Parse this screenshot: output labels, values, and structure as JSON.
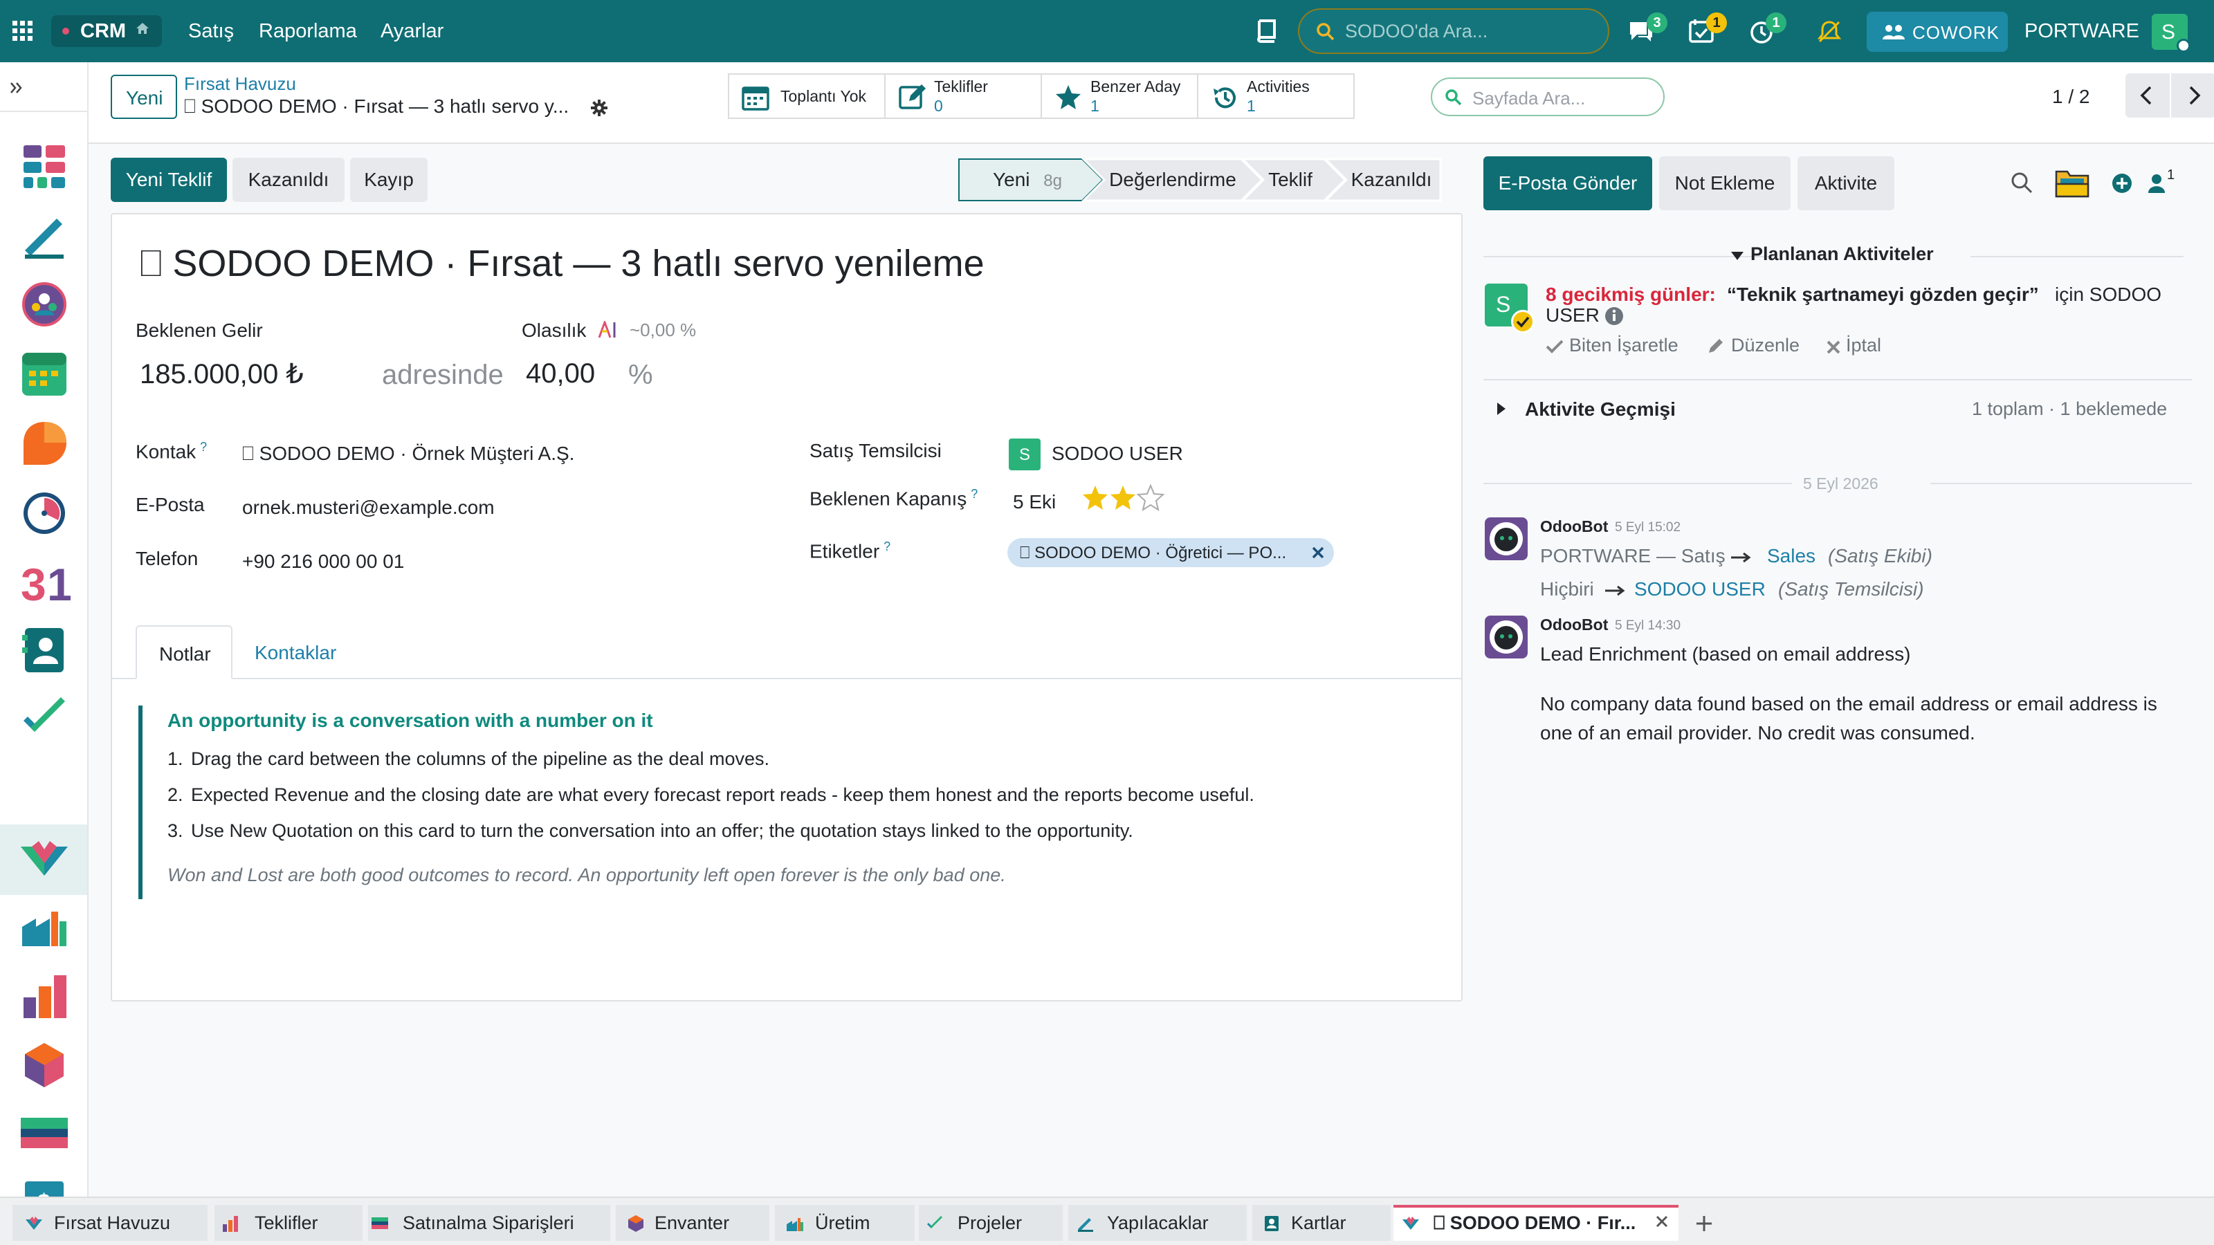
{
  "topbar": {
    "app_name": "CRM",
    "menus": [
      "Satış",
      "Raporlama",
      "Ayarlar"
    ],
    "search_placeholder": "SODOO'da Ara...",
    "badge_messages": "3",
    "badge_activities": "1",
    "badge_timer": "1",
    "cowork_label": "COWORK",
    "company": "PORTWARE",
    "avatar_letter": "S"
  },
  "control": {
    "new_label": "Yeni",
    "breadcrumb_parent": "Fırsat Havuzu",
    "breadcrumb_current": "⎕ SODOO DEMO · Fırsat — 3 hatlı servo y...",
    "smart_buttons": [
      {
        "label": "Toplantı Yok",
        "count": ""
      },
      {
        "label": "Teklifler",
        "count": "0"
      },
      {
        "label": "Benzer Aday",
        "count": "1"
      },
      {
        "label": "Activities",
        "count": "1"
      }
    ],
    "page_search_placeholder": "Sayfada Ara...",
    "pager": "1 / 2"
  },
  "actions": {
    "new_quotation": "Yeni Teklif",
    "won": "Kazanıldı",
    "lost": "Kayıp"
  },
  "stages": [
    {
      "label": "Yeni",
      "days": "8g",
      "active": true
    },
    {
      "label": "Değerlendirme"
    },
    {
      "label": "Teklif"
    },
    {
      "label": "Kazanıldı"
    }
  ],
  "form": {
    "title": "⎕ SODOO DEMO · Fırsat — 3 hatlı servo yenileme",
    "expected_revenue_label": "Beklenen Gelir",
    "expected_revenue": "185.000,00 ₺",
    "at_label": "adresinde",
    "probability_label": "Olasılık",
    "probability_ai": "~0,00 %",
    "probability": "40,00",
    "percent": "%",
    "contact_label": "Kontak",
    "contact": "⎕ SODOO DEMO · Örnek Müşteri A.Ş.",
    "email_label": "E-Posta",
    "email": "ornek.musteri@example.com",
    "phone_label": "Telefon",
    "phone": "+90 216 000 00 01",
    "salesperson_label": "Satış Temsilcisi",
    "salesperson": "SODOO USER",
    "salesperson_avatar": "S",
    "expected_closing_label": "Beklenen Kapanış",
    "expected_closing": "5 Eki",
    "priority_stars": 2,
    "tags_label": "Etiketler",
    "tag": "⎕ SODOO DEMO · Öğretici — PO...",
    "help_mark": "?"
  },
  "tabs": [
    "Notlar",
    "Kontaklar"
  ],
  "notes": {
    "heading": "An opportunity is a conversation with a number on it",
    "items": [
      "Drag the card between the columns of the pipeline as the deal moves.",
      "Expected Revenue and the closing date are what every forecast report reads - keep them honest and the reports become useful.",
      "Use New Quotation on this card to turn the conversation into an offer; the quotation stays linked to the opportunity."
    ],
    "footer": "Won and Lost are both good outcomes to record. An opportunity left open forever is the only bad one."
  },
  "chatter": {
    "send_email": "E-Posta Gönder",
    "log_note": "Not Ekleme",
    "activity": "Aktivite",
    "followers_count": "1",
    "planned_title": "Planlanan Aktiviteler",
    "overdue": "8 gecikmiş günler:",
    "activity_title": "“Teknik şartnameyi gözden geçir”",
    "for_user": "için SODOO",
    "for_user2": "USER",
    "mark_done": "Biten İşaretle",
    "edit": "Düzenle",
    "cancel": "İptal",
    "history_title": "Aktivite Geçmişi",
    "history_summary": "1 toplam · 1 beklemede",
    "date_separator": "5 Eyl 2026",
    "messages": [
      {
        "author": "OdooBot",
        "time": "5 Eyl 15:02",
        "changes": [
          {
            "old": "PORTWARE — Satış",
            "new": "Sales",
            "field": "(Satış Ekibi)"
          },
          {
            "old": "Hiçbiri",
            "new": "SODOO USER",
            "field": "(Satış Temsilcisi)"
          }
        ]
      },
      {
        "author": "OdooBot",
        "time": "5 Eyl 14:30",
        "body1": "Lead Enrichment (based on email address)",
        "body2": "No company data found based on the email address or email address is",
        "body3": "one of an email provider. No credit was consumed."
      }
    ]
  },
  "bottom_tabs": [
    {
      "label": "Fırsat Havuzu"
    },
    {
      "label": "Teklifler"
    },
    {
      "label": "Satınalma Siparişleri"
    },
    {
      "label": "Envanter"
    },
    {
      "label": "Üretim"
    },
    {
      "label": "Projeler"
    },
    {
      "label": "Yapılacaklar"
    },
    {
      "label": "Kartlar"
    },
    {
      "label": "⎕ SODOO DEMO · Fır..."
    }
  ],
  "colors": {
    "brand": "#0f6e74",
    "link": "#1d7fa8",
    "overdue": "#d9263b",
    "star": "#f3c20a"
  }
}
